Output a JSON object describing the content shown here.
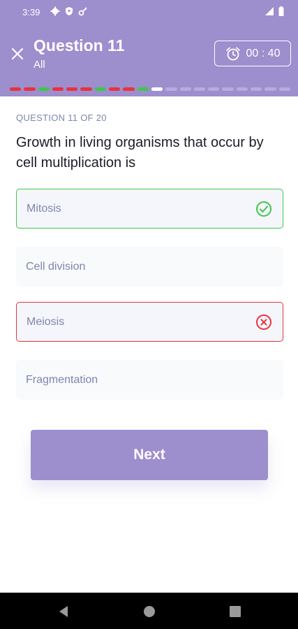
{
  "status_bar": {
    "time": "3:39"
  },
  "header": {
    "title": "Question 11",
    "subtitle": "All",
    "timer": "00 : 40",
    "progress": [
      "red",
      "red",
      "green",
      "red",
      "red",
      "red",
      "green",
      "red",
      "red",
      "green",
      "current",
      "pending",
      "pending",
      "pending",
      "pending",
      "pending",
      "pending",
      "pending",
      "pending",
      "pending"
    ]
  },
  "question": {
    "counter": "QUESTION 11 OF 20",
    "text": "Growth in living organisms that occur by cell multiplication is"
  },
  "options": [
    {
      "label": "Mitosis",
      "state": "correct"
    },
    {
      "label": "Cell division",
      "state": "neutral"
    },
    {
      "label": "Meiosis",
      "state": "wrong"
    },
    {
      "label": "Fragmentation",
      "state": "neutral"
    }
  ],
  "next_label": "Next",
  "colors": {
    "accent": "#9d8ecd",
    "correct": "#3fc74a",
    "wrong": "#e8323e",
    "current": "#ffffff",
    "pending": "#b7abdf"
  }
}
